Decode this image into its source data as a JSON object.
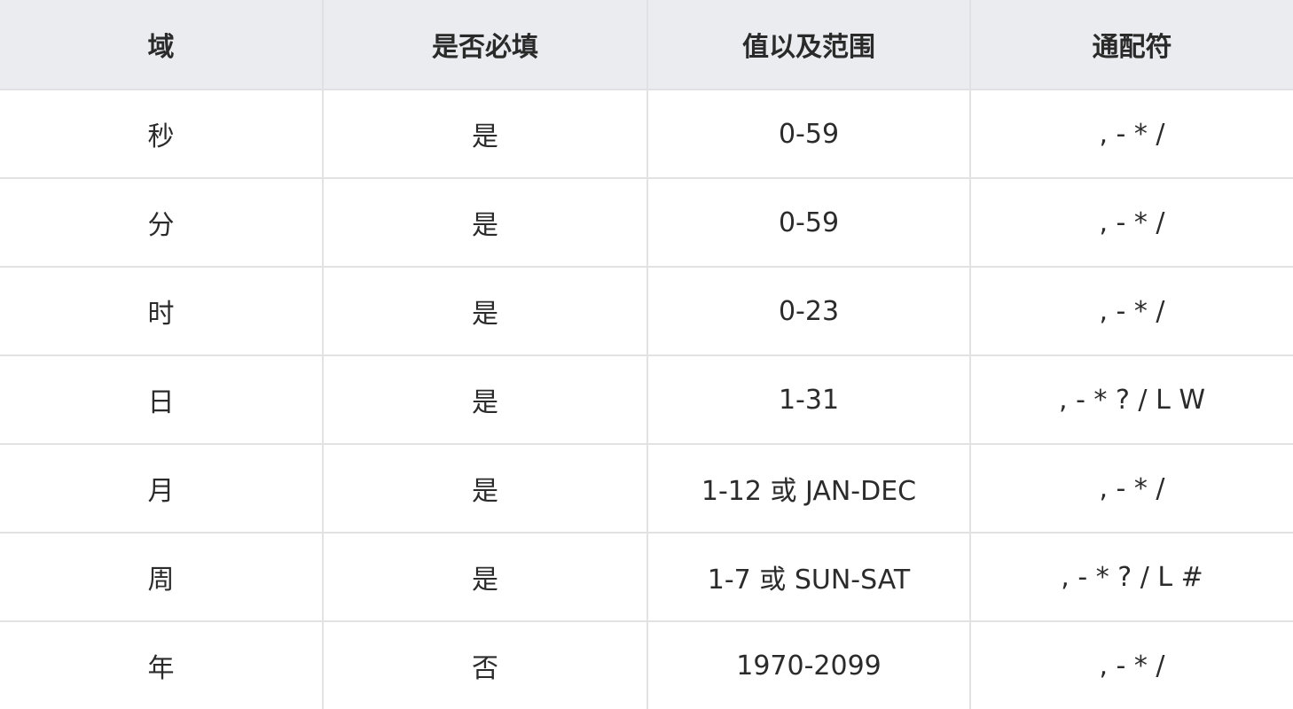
{
  "table": {
    "headers": [
      "域",
      "是否必填",
      "值以及范围",
      "通配符"
    ],
    "rows": [
      [
        "秒",
        "是",
        "0-59",
        ", - * /"
      ],
      [
        "分",
        "是",
        "0-59",
        ", - * /"
      ],
      [
        "时",
        "是",
        "0-23",
        ", - * /"
      ],
      [
        "日",
        "是",
        "1-31",
        ", - * ? / L W"
      ],
      [
        "月",
        "是",
        "1-12 或 JAN-DEC",
        ", - * /"
      ],
      [
        "周",
        "是",
        "1-7 或 SUN-SAT",
        ", - * ? / L #"
      ],
      [
        "年",
        "否",
        "1970-2099",
        ", - * /"
      ]
    ]
  }
}
